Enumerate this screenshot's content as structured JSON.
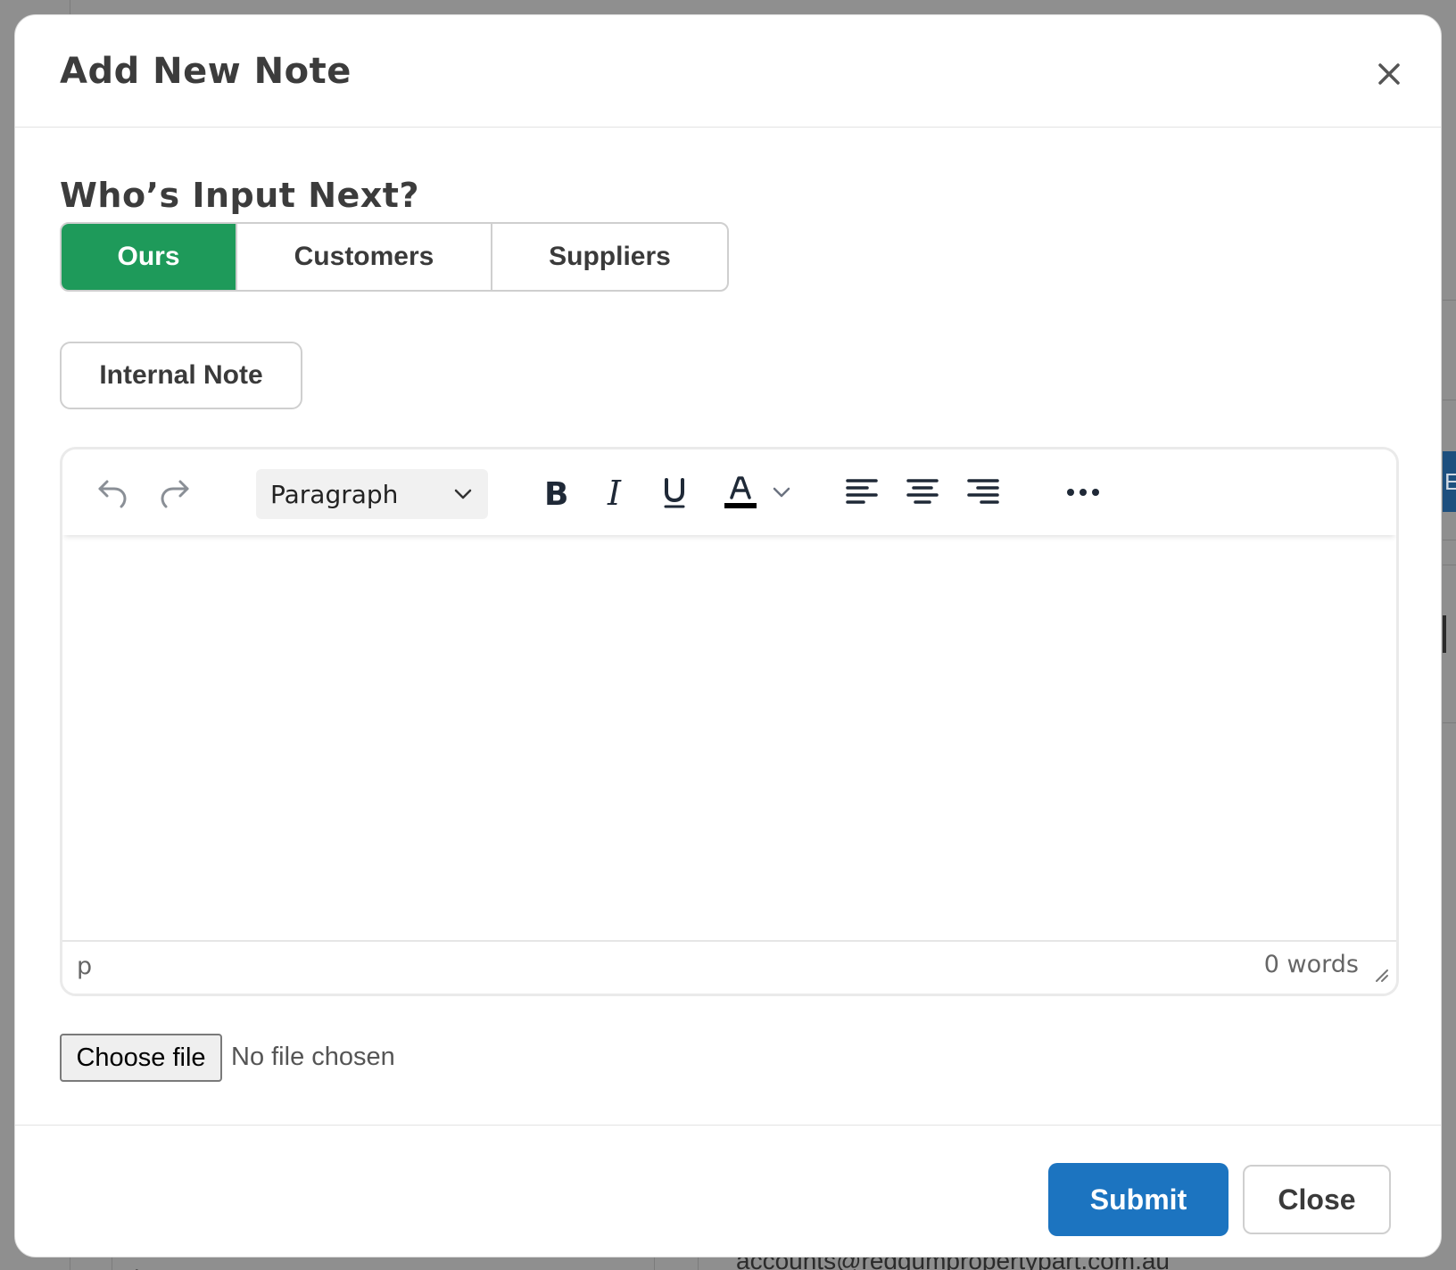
{
  "backdrop": {
    "email_text": "accounts@redgumpropertypart.com.au",
    "right_badge_text": "E",
    "bottom_left_text": "."
  },
  "modal": {
    "title": "Add New Note",
    "close_icon": "close-icon"
  },
  "input_next": {
    "heading": "Who’s Input Next?",
    "options": [
      "Ours",
      "Customers",
      "Suppliers"
    ],
    "selected": "Ours",
    "active_color": "#1e9a5a"
  },
  "note_type": {
    "label": "Internal Note"
  },
  "editor": {
    "toolbar": {
      "undo_icon": "undo-icon",
      "redo_icon": "redo-icon",
      "block_format": "Paragraph",
      "bold_icon": "bold-icon",
      "italic_icon": "italic-icon",
      "underline_icon": "underline-icon",
      "text_color_icon": "text-color-icon",
      "align_left_icon": "align-left-icon",
      "align_center_icon": "align-center-icon",
      "align_right_icon": "align-right-icon",
      "more_icon": "more-icon"
    },
    "content": "",
    "status_path": "p",
    "word_count": "0 words"
  },
  "file_input": {
    "button_label": "Choose file",
    "status": "No file chosen"
  },
  "footer": {
    "submit_label": "Submit",
    "close_label": "Close",
    "submit_color": "#1c74c0"
  }
}
